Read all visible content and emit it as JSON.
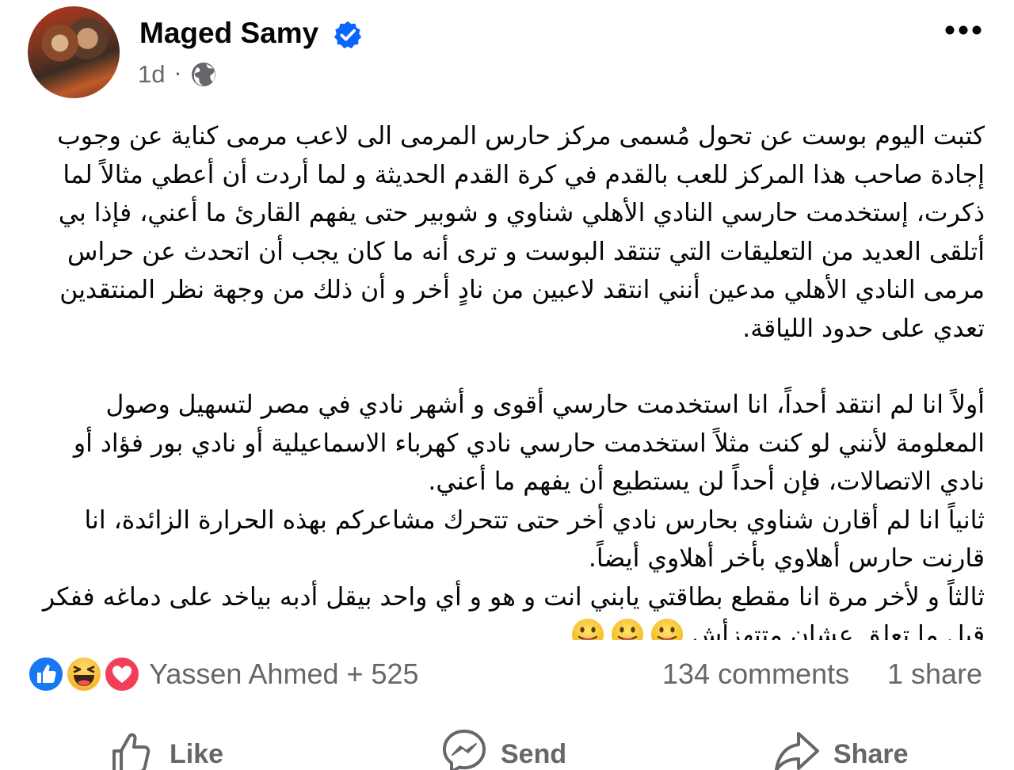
{
  "post": {
    "author": "Maged Samy",
    "time": "1d",
    "time_separator": "·",
    "icons": {
      "verified": "verified-badge-icon",
      "audience": "globe-icon",
      "more": "more-options-icon"
    },
    "body": [
      "كتبت اليوم بوست عن تحول مُسمى مركز حارس المرمى الى لاعب مرمى كناية عن وجوب إجادة صاحب هذا المركز للعب بالقدم في كرة القدم الحديثة و لما أردت أن أعطي مثالاً لما ذكرت، إستخدمت حارسي النادي الأهلي شناوي و شوبير حتى يفهم القارئ ما أعني، فإذا بي أتلقى العديد من التعليقات التي تنتقد البوست و ترى أنه ما كان يجب أن اتحدث عن حراس مرمى النادي الأهلي مدعين أنني انتقد لاعبين من نادٍ أخر و أن ذلك من وجهة نظر المنتقدين تعدي على حدود اللياقة.",
      "أولاً انا لم انتقد أحداً، انا استخدمت حارسي أقوى و أشهر نادي في مصر لتسهيل وصول المعلومة لأنني لو كنت مثلاً استخدمت حارسي نادي كهرباء الاسماعيلية أو نادي بور فؤاد أو نادي الاتصالات، فإن أحداً لن يستطيع أن يفهم ما أعني.",
      "ثانياً انا لم أقارن شناوي بحارس نادي أخر حتى تتحرك مشاعركم بهذه الحرارة الزائدة، انا قارنت حارس أهلاوي بأخر أهلاوي أيضاً.",
      "ثالثاً و لأخر مرة انا مقطع بطاقتي يابني انت و هو و أي واحد بيقل أدبه بياخد على دماغه ففكر قبل ما تعلق عشان متتهزأش"
    ],
    "body_emojis": [
      "face-with-tongue-icon",
      "face-with-tongue-icon",
      "face-with-tongue-icon"
    ]
  },
  "engagement": {
    "reaction_icons": [
      "like-reaction-icon",
      "haha-reaction-icon",
      "love-reaction-icon"
    ],
    "reactors": "Yassen Ahmed + 525",
    "comments": "134 comments",
    "shares": "1 share"
  },
  "actions": {
    "like": "Like",
    "send": "Send",
    "share": "Share"
  },
  "colors": {
    "text": "#050505",
    "secondary_text": "#65676b",
    "verified_blue": "#0866ff",
    "like_blue": "#1877f2",
    "love_red": "#f33e58",
    "haha_yellow": "#f7b125"
  }
}
